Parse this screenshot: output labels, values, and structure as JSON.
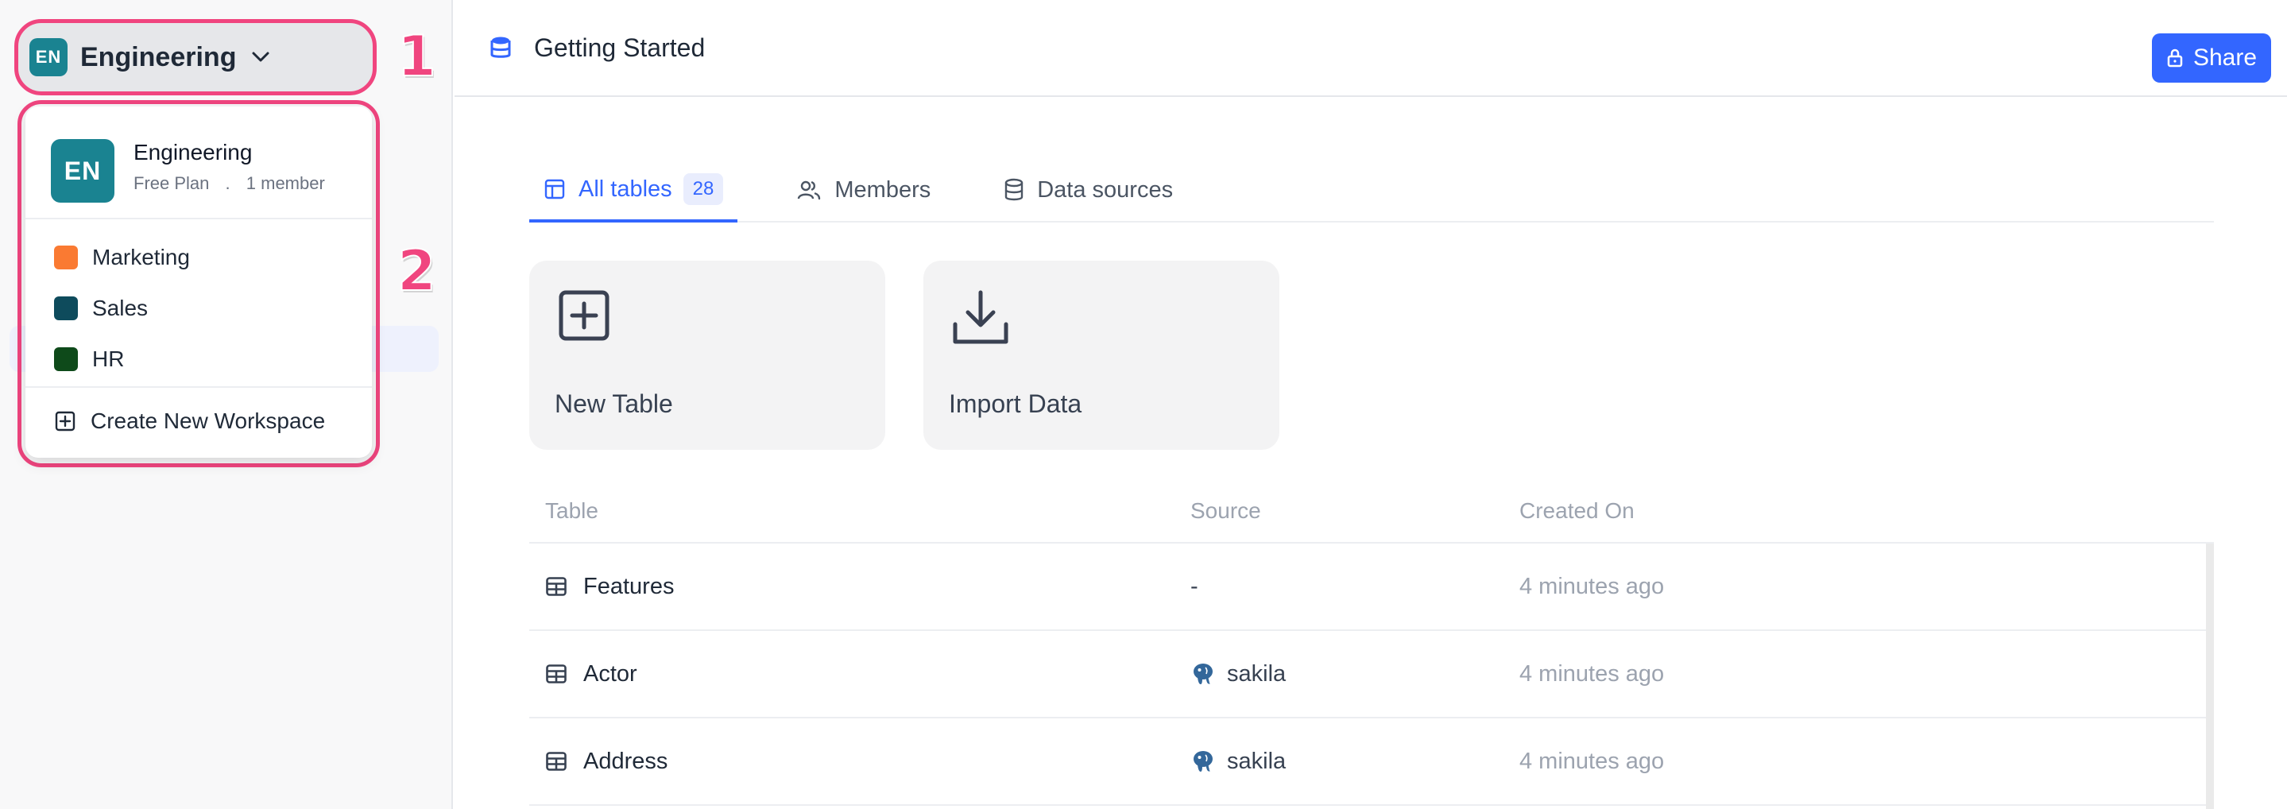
{
  "workspace": {
    "initials": "EN",
    "name": "Engineering",
    "plan": "Free Plan",
    "separator": ".",
    "members": "1 member",
    "others": [
      {
        "name": "Marketing",
        "color": "#fa7a32"
      },
      {
        "name": "Sales",
        "color": "#0e4b5c"
      },
      {
        "name": "HR",
        "color": "#0e4a1a"
      }
    ],
    "create_label": "Create New Workspace"
  },
  "callouts": [
    "1",
    "2"
  ],
  "header": {
    "title": "Getting Started",
    "share_label": "Share"
  },
  "tabs": [
    {
      "label": "All tables",
      "badge": "28",
      "icon": "table-layout-icon"
    },
    {
      "label": "Members",
      "icon": "users-icon"
    },
    {
      "label": "Data sources",
      "icon": "database-icon"
    }
  ],
  "cards": [
    {
      "label": "New Table",
      "icon": "plus-square-icon"
    },
    {
      "label": "Import Data",
      "icon": "download-icon"
    }
  ],
  "table": {
    "columns": [
      "Table",
      "Source",
      "Created On"
    ],
    "rows": [
      {
        "name": "Features",
        "source": "-",
        "created": "4 minutes ago"
      },
      {
        "name": "Actor",
        "source": "sakila",
        "created": "4 minutes ago"
      },
      {
        "name": "Address",
        "source": "sakila",
        "created": "4 minutes ago"
      }
    ]
  },
  "colors": {
    "accent": "#3366ff",
    "callout": "#f0457f",
    "workspace_avatar": "#1a8391"
  }
}
